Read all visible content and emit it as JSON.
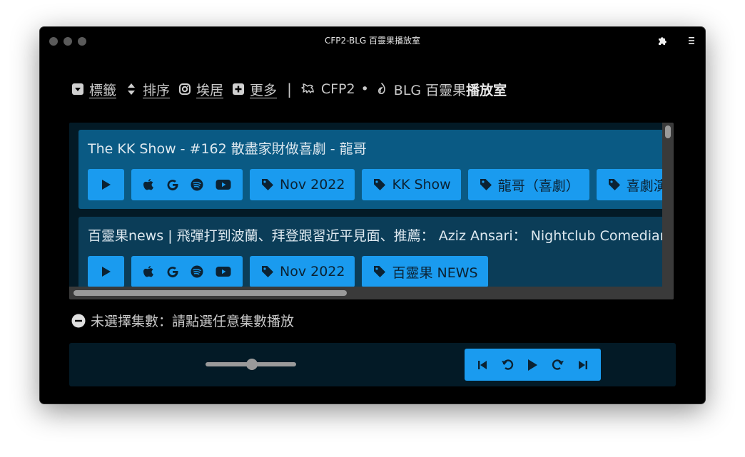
{
  "window": {
    "title": "CFP2-BLG 百靈果播放室"
  },
  "nav": {
    "tags_label": "標籤",
    "sort_label": "排序",
    "ig_label": "埃居",
    "more_label": "更多",
    "separator": "|",
    "cfp2_label": "CFP2",
    "bullet": "•",
    "blg_label": "BLG 百靈果",
    "blg_bold": "播放室"
  },
  "episodes": [
    {
      "title": "The KK Show - #162 散盡家財做喜劇 - 龍哥",
      "tags": [
        "Nov 2022",
        "KK Show",
        "龍哥（喜劇）",
        "喜劇演"
      ],
      "bg": "#0a5a84"
    },
    {
      "title": "百靈果news | 飛彈打到波蘭、拜登跟習近平見面、推薦： Aziz Ansari： Nightclub Comedian",
      "tags": [
        "Nov 2022",
        "百靈果 NEWS"
      ],
      "bg": "#0b3d58"
    }
  ],
  "status": {
    "text": "未選擇集數：請點選任意集數播放"
  },
  "player": {
    "volume_fraction": 0.5
  },
  "colors": {
    "accent": "#1a9bef",
    "panel": "#031a26",
    "window_bg": "#000000"
  },
  "icons": [
    "caret-square-down-icon",
    "sort-icon",
    "instagram-icon",
    "plus-square-icon",
    "dragon-icon",
    "leaf-icon",
    "play-icon",
    "apple-icon",
    "google-icon",
    "spotify-icon",
    "youtube-icon",
    "tag-icon",
    "skip-back-icon",
    "rewind-icon",
    "skip-forward-icon",
    "forward-icon",
    "puzzle-icon",
    "menu-icon",
    "minus-circle-icon"
  ]
}
